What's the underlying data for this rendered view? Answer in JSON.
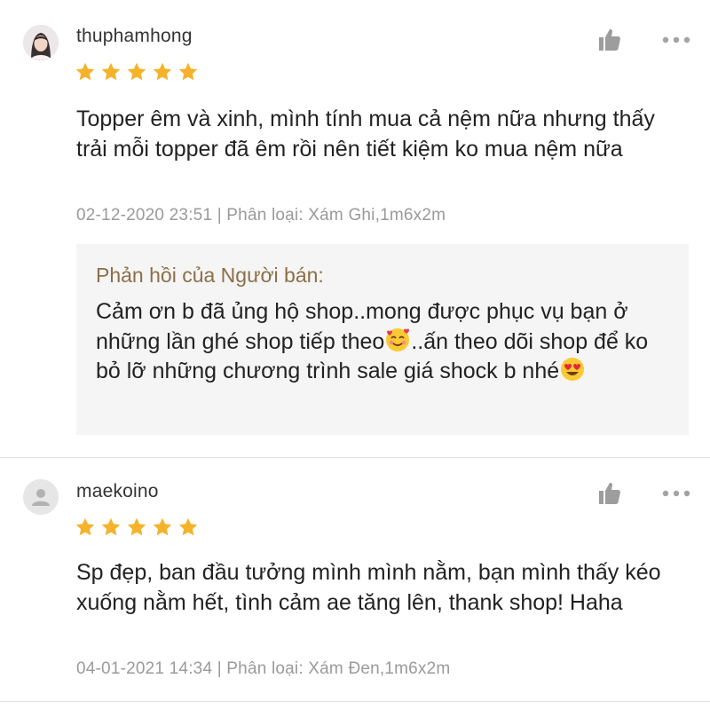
{
  "reviews": [
    {
      "username": "thuphamhong",
      "rating": 5,
      "content": "Topper êm và xinh, mình tính mua cả nệm nữa nhưng thấy trải mỗi topper đã êm rồi nên tiết kiệm ko mua nệm nữa",
      "meta": "02-12-2020 23:51 | Phân loại: Xám Ghi,1m6x2m",
      "seller_reply": {
        "title": "Phản hồi của Người bán:",
        "text_part1": "Cảm ơn b đã ủng hộ shop..mong được phục vụ bạn ở những lần ghé shop tiếp theo",
        "text_part2": "..ấn theo dõi shop để ko bỏ lỡ những chương trình sale giá shock b nhé"
      }
    },
    {
      "username": "maekoino",
      "rating": 5,
      "content": "Sp đẹp, ban đầu tưởng mình mình nằm, bạn mình thấy kéo xuống nằm hết, tình cảm ae tăng lên, thank shop! Haha",
      "meta": "04-01-2021 14:34 | Phân loại: Xám Đen,1m6x2m"
    }
  ],
  "icons": {
    "like": "thumbs-up-icon",
    "more": "more-dots-icon",
    "star": "star-icon",
    "default_avatar": "user-icon",
    "emoji_1": "smiling-face-with-hearts",
    "emoji_2": "heart-eyes-face"
  },
  "colors": {
    "star": "#f5b32b",
    "reply_title": "#8d6e47",
    "meta": "#9a9a9a",
    "reply_bg": "#f5f5f5"
  }
}
